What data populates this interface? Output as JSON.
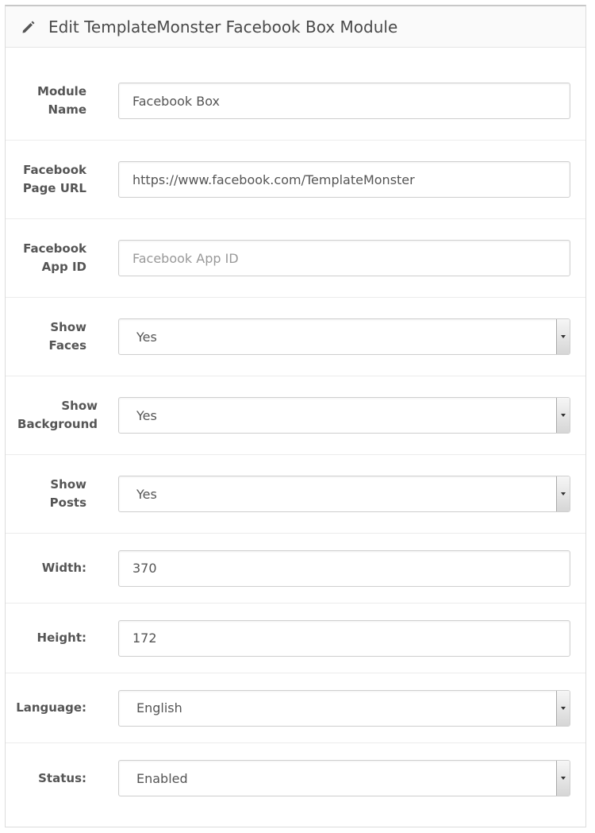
{
  "panel": {
    "title": "Edit TemplateMonster Facebook Box Module",
    "icon": "pencil-icon"
  },
  "form": {
    "module_name": {
      "label": "Module\nName",
      "value": "Facebook Box"
    },
    "page_url": {
      "label": "Facebook\nPage URL",
      "value": "https://www.facebook.com/TemplateMonster"
    },
    "app_id": {
      "label": "Facebook\nApp ID",
      "value": "",
      "placeholder": "Facebook App ID"
    },
    "show_faces": {
      "label": "Show\nFaces",
      "value": "Yes"
    },
    "show_background": {
      "label": "Show\nBackground",
      "value": "Yes"
    },
    "show_posts": {
      "label": "Show\nPosts",
      "value": "Yes"
    },
    "width": {
      "label": "Width:",
      "value": "370"
    },
    "height": {
      "label": "Height:",
      "value": "172"
    },
    "language": {
      "label": "Language:",
      "value": "English"
    },
    "status": {
      "label": "Status:",
      "value": "Enabled"
    }
  }
}
